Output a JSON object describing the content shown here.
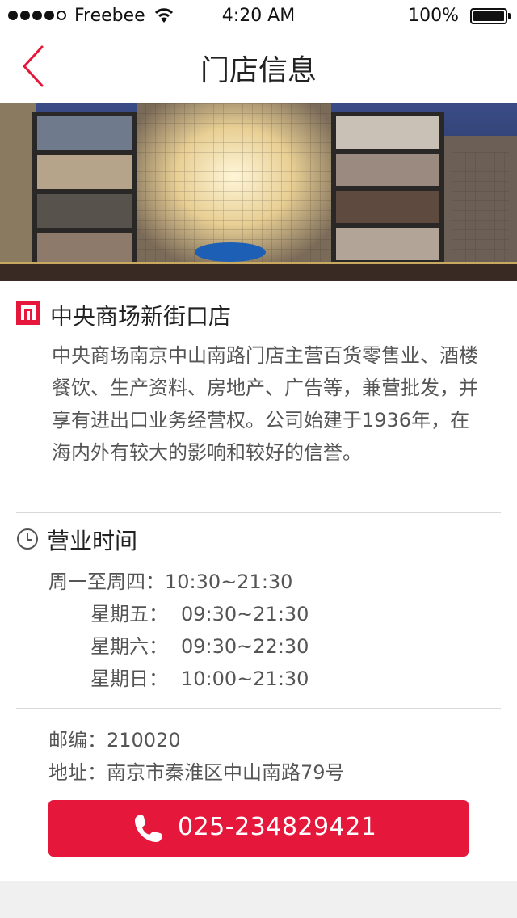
{
  "status_bar": {
    "carrier": "Freebee",
    "time": "4:20 AM",
    "battery": "100%"
  },
  "nav": {
    "title": "门店信息",
    "back_icon": "chevron-left-icon"
  },
  "store": {
    "name": "中央商场新街口店",
    "description": "中央商场南京中山南路门店主营百货零售业、酒楼餐饮、生产资料、房地产、广告等，兼营批发，并享有进出口业务经营权。公司始建于1936年，在海内外有较大的影响和较好的信誉。"
  },
  "hours": {
    "title": "营业时间",
    "rows": [
      {
        "days": "周一至周四：",
        "time": "10:30~21:30"
      },
      {
        "days": "星期五：",
        "time": "09:30~21:30"
      },
      {
        "days": "星期六：",
        "time": "09:30~22:30"
      },
      {
        "days": "星期日：",
        "time": "10:00~21:30"
      }
    ]
  },
  "contact": {
    "postcode_label": "邮编：",
    "postcode": "210020",
    "address_label": "地址：",
    "address": "南京市秦淮区中山南路79号",
    "phone": "025-234829421"
  },
  "colors": {
    "accent": "#e5173a",
    "text": "#555555"
  }
}
